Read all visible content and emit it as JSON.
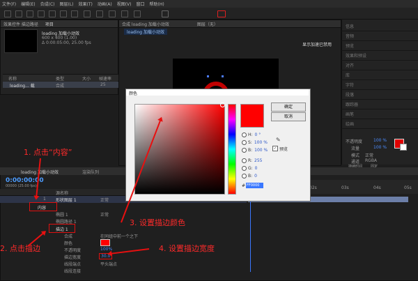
{
  "menu": [
    "文件(F)",
    "编辑(E)",
    "合成(C)",
    "图层(L)",
    "效果(T)",
    "动画(A)",
    "视图(V)",
    "窗口",
    "帮助(H)"
  ],
  "project": {
    "tab": "项目",
    "effects_tab": "效果控件 描边路径",
    "comp_name": "loading 加载小动效",
    "comp_size": "600 x 400 (1.00)",
    "comp_dur": "Δ 0:00:05:00, 25.00 fps",
    "col_name": "名称",
    "col_type": "类型",
    "col_size": "大小",
    "col_rate": "帧速率",
    "row_name": "loading... 载",
    "row_type": "合成",
    "row_rate": "25"
  },
  "viewer": {
    "tab": "合成 loading 加载小动效",
    "tab_active": "loading 加载小动效",
    "layer_tab": "图层（无）",
    "gpu_notice": "显示加速已禁用"
  },
  "right_panel": [
    "信息",
    "音频",
    "预览",
    "效果和预设",
    "对齐",
    "库",
    "字符",
    "段落",
    "跟踪器",
    "画笔",
    "绘画"
  ],
  "right_props": {
    "opacity_label": "不透明度",
    "opacity_value": "100 %",
    "flow_label": "流量",
    "flow_value": "100 %",
    "mode_label": "模式",
    "mode_value": "正常",
    "channel_label": "通道",
    "channel_value": "RGBA",
    "duration_label": "持续时间",
    "duration_value": "固定"
  },
  "timeline": {
    "tab": "loading 加载小动效",
    "render_tab": "渲染队列",
    "timecode": "0:00:00:00",
    "timecode_sub": "00000 (25.00 fps)",
    "col_source": "源名称",
    "layer_num": "1",
    "layer_name": "形状图层 1",
    "contents": "内容",
    "shape_group": "椭圆 1",
    "path": "椭圆路径 1",
    "stroke": "描边 1",
    "composite": "合成",
    "composite_val": "在同组中前一个之下",
    "color": "颜色",
    "opacity_row": "不透明度",
    "opacity_row_val": "100%",
    "width_row": "描边宽度",
    "width_row_val": "30.0",
    "linecap": "线段端点",
    "linecap_val": "平头端点",
    "linejoin": "线段连接",
    "mode_normal": "正常",
    "mode_normal2": "正常",
    "ruler": [
      "0s",
      "01s",
      "02s",
      "03s",
      "04s",
      "05s"
    ]
  },
  "color_dialog": {
    "title": "颜色",
    "ok": "确定",
    "cancel": "取消",
    "h_label": "H:",
    "h_value": "0 °",
    "s_label": "S:",
    "s_value": "100 %",
    "b_label": "B:",
    "b_value": "100 %",
    "r_label": "R:",
    "r_value": "255",
    "g_label": "G:",
    "g_value": "0",
    "bl_label": "B:",
    "bl_value": "0",
    "hex_label": "#",
    "hex_value": "FF0000",
    "preview_label": "预览",
    "swatch_color": "#ff0000"
  },
  "annotations": {
    "step1": "1. 点击“内容”",
    "step2": "2. 点击描边",
    "step3": "3. 设置描边颜色",
    "step4": "4. 设置描边宽度"
  }
}
